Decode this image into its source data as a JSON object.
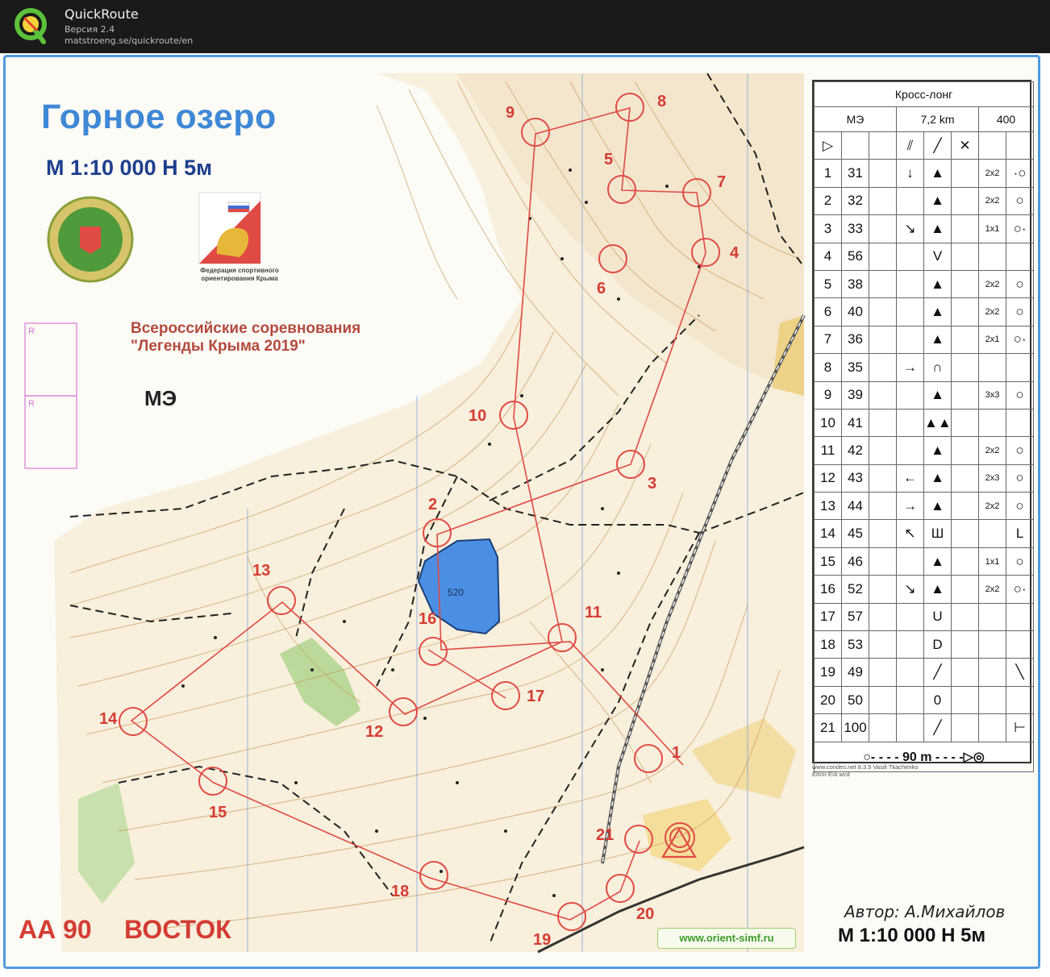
{
  "app": {
    "title": "QuickRoute",
    "version": "Версия 2.4",
    "url": "matstroeng.se/quickroute/en"
  },
  "map": {
    "title": "Горное озеро",
    "scale_top": "М 1:10 000   Н 5м",
    "event_line1": "Всероссийские соревнования",
    "event_line2": "\"Легенды Крыма 2019\"",
    "class_label": "МЭ",
    "federation_caption": "Федерация спортивного ориентирования Крыма",
    "map_code": "АА 90",
    "area": "ВОСТОК",
    "author": "Автор: А.Михайлов",
    "scale_bottom": "М 1:10 000  Н 5м",
    "website": "www.orient-simf.ru",
    "lake_height": "520",
    "credit_line1": "www.condes.net 8.3.5 Vasili Tkachenko",
    "credit_line2": "Êôîííí-Ëìä wcd",
    "release_box_label": "R"
  },
  "description_sheet": {
    "course_name": "Кросс-лонг",
    "class": "МЭ",
    "length": "7,2 km",
    "climb": "400",
    "start_symbol": "▷",
    "rows": [
      {
        "n": "1",
        "code": "31",
        "dir": "↓",
        "feature": "▲",
        "dim": "2x2",
        "pos": "·○"
      },
      {
        "n": "2",
        "code": "32",
        "dir": "",
        "feature": "▲",
        "dim": "2x2",
        "pos": "○"
      },
      {
        "n": "3",
        "code": "33",
        "dir": "↘",
        "feature": "▲",
        "dim": "1x1",
        "pos": "○·"
      },
      {
        "n": "4",
        "code": "56",
        "dir": "",
        "feature": "V",
        "dim": "",
        "pos": ""
      },
      {
        "n": "5",
        "code": "38",
        "dir": "",
        "feature": "▲",
        "dim": "2x2",
        "pos": "○"
      },
      {
        "n": "6",
        "code": "40",
        "dir": "",
        "feature": "▲",
        "dim": "2x2",
        "pos": "○"
      },
      {
        "n": "7",
        "code": "36",
        "dir": "",
        "feature": "▲",
        "dim": "2x1",
        "pos": "○·"
      },
      {
        "n": "8",
        "code": "35",
        "dir": "→",
        "feature": "∩",
        "dim": "",
        "pos": ""
      },
      {
        "n": "9",
        "code": "39",
        "dir": "",
        "feature": "▲",
        "dim": "3x3",
        "pos": "○"
      },
      {
        "n": "10",
        "code": "41",
        "dir": "",
        "feature": "▲▲",
        "dim": "",
        "pos": ""
      },
      {
        "n": "11",
        "code": "42",
        "dir": "",
        "feature": "▲",
        "dim": "2x2",
        "pos": "○"
      },
      {
        "n": "12",
        "code": "43",
        "dir": "←",
        "feature": "▲",
        "dim": "2x3",
        "pos": "○"
      },
      {
        "n": "13",
        "code": "44",
        "dir": "→",
        "feature": "▲",
        "dim": "2x2",
        "pos": "○"
      },
      {
        "n": "14",
        "code": "45",
        "dir": "↖",
        "feature": "Ш",
        "dim": "",
        "pos": "L"
      },
      {
        "n": "15",
        "code": "46",
        "dir": "",
        "feature": "▲",
        "dim": "1x1",
        "pos": "○"
      },
      {
        "n": "16",
        "code": "52",
        "dir": "↘",
        "feature": "▲",
        "dim": "2x2",
        "pos": "○·"
      },
      {
        "n": "17",
        "code": "57",
        "dir": "",
        "feature": "U",
        "dim": "",
        "pos": ""
      },
      {
        "n": "18",
        "code": "53",
        "dir": "",
        "feature": "D",
        "dim": "",
        "pos": ""
      },
      {
        "n": "19",
        "code": "49",
        "dir": "",
        "feature": "╱",
        "dim": "",
        "pos": "╲"
      },
      {
        "n": "20",
        "code": "50",
        "dir": "",
        "feature": "0",
        "dim": "",
        "pos": ""
      },
      {
        "n": "21",
        "code": "100",
        "dir": "",
        "feature": "╱",
        "dim": "",
        "pos": "⊢"
      }
    ],
    "finish_text": "○- - - - 90 m - - - -▷◎"
  },
  "controls": [
    {
      "n": "1"
    },
    {
      "n": "2"
    },
    {
      "n": "3"
    },
    {
      "n": "4"
    },
    {
      "n": "5"
    },
    {
      "n": "6"
    },
    {
      "n": "7"
    },
    {
      "n": "8"
    },
    {
      "n": "9"
    },
    {
      "n": "10"
    },
    {
      "n": "11"
    },
    {
      "n": "12"
    },
    {
      "n": "13"
    },
    {
      "n": "14"
    },
    {
      "n": "15"
    },
    {
      "n": "16"
    },
    {
      "n": "17"
    },
    {
      "n": "18"
    },
    {
      "n": "19"
    },
    {
      "n": "20"
    },
    {
      "n": "21"
    }
  ],
  "colors": {
    "course": "#e04a44",
    "water": "#4a8fe3",
    "contour": "#c89a5a",
    "vegetation": "#8cc46a",
    "frame": "#4f9be0"
  }
}
